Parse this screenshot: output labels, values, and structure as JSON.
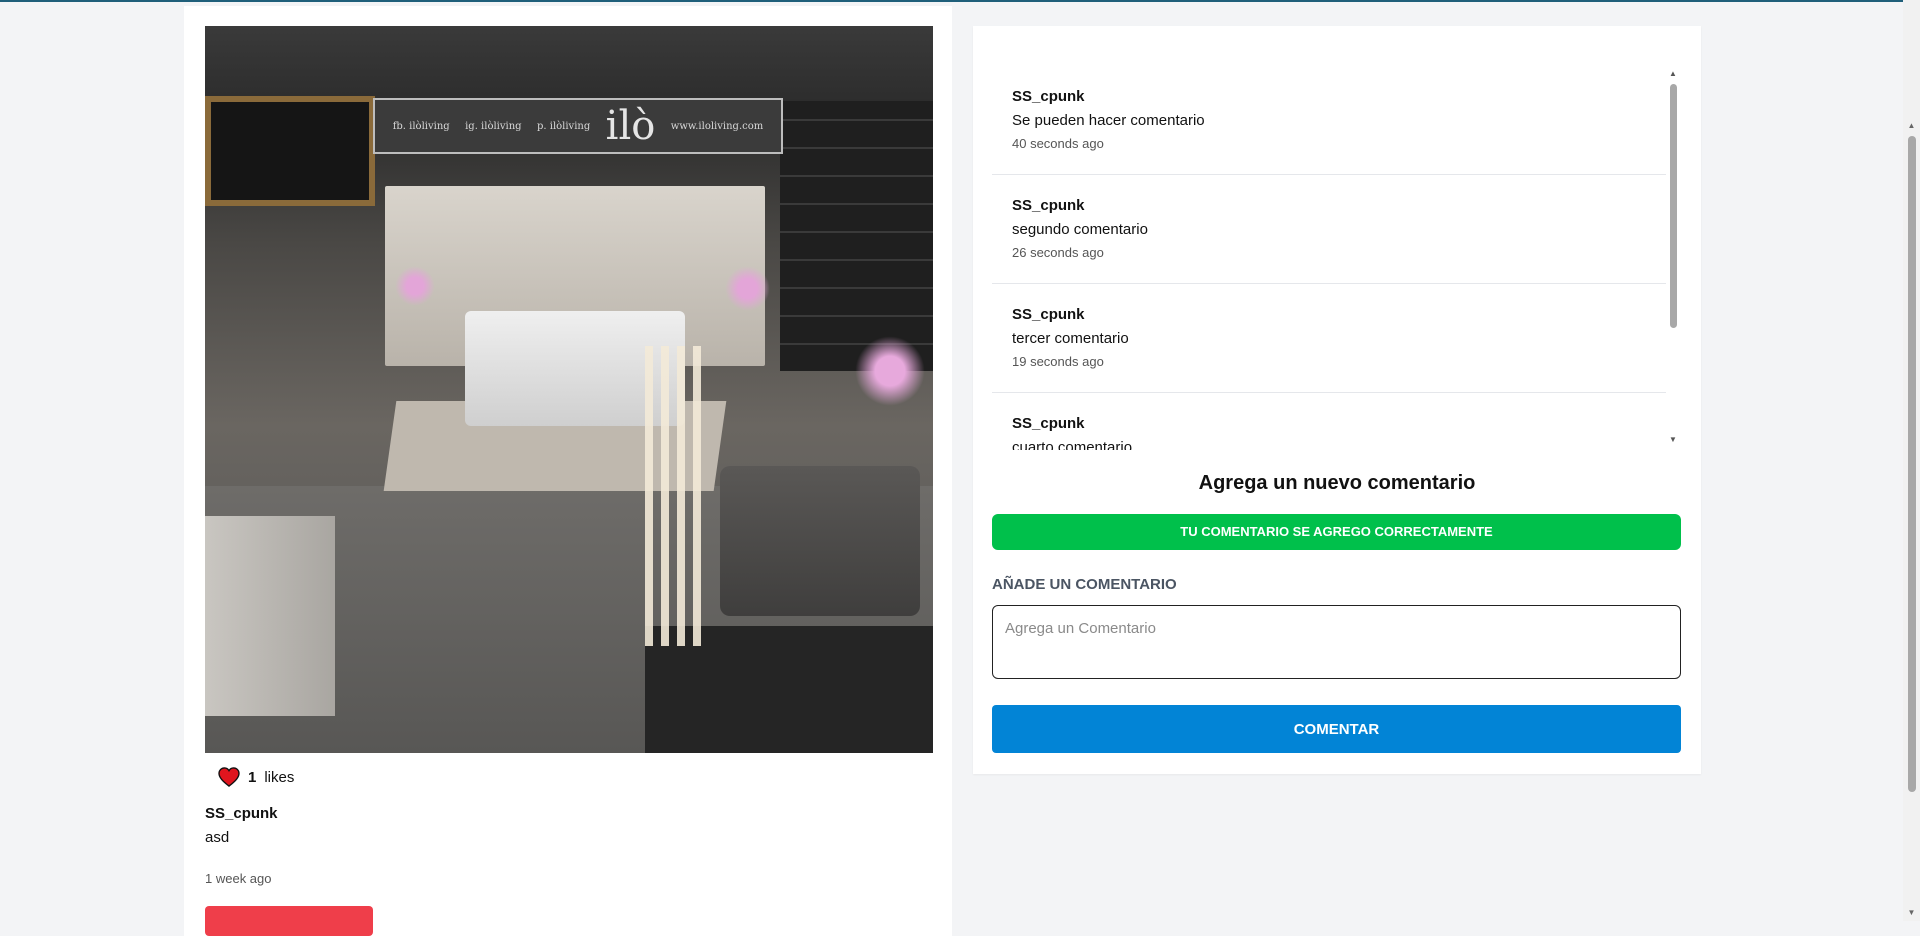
{
  "post": {
    "likes_count": "1",
    "likes_label": "likes",
    "username": "SS_cpunk",
    "description": "asd",
    "time": "1 week ago",
    "image_banner": {
      "logo": "ilò",
      "fb": "fb. ilòliving",
      "ig": "ig. ilòliving",
      "p": "p. ilòliving",
      "site": "www.iloliving.com"
    }
  },
  "comments": [
    {
      "user": "SS_cpunk",
      "text": "Se pueden hacer comentario",
      "time": "40 seconds ago"
    },
    {
      "user": "SS_cpunk",
      "text": "segundo comentario",
      "time": "26 seconds ago"
    },
    {
      "user": "SS_cpunk",
      "text": "tercer comentario",
      "time": "19 seconds ago"
    },
    {
      "user": "SS_cpunk",
      "text": "cuarto comentario",
      "time": ""
    }
  ],
  "form": {
    "heading": "Agrega un nuevo comentario",
    "success_message": "TU COMENTARIO SE AGREGO CORRECTAMENTE",
    "field_label": "AÑADE UN COMENTARIO",
    "placeholder": "Agrega un Comentario",
    "submit_label": "COMENTAR"
  },
  "icons": {
    "like": "heart-icon",
    "scroll_up": "triangle-up-icon",
    "scroll_down": "triangle-down-icon"
  },
  "colors": {
    "success": "#00c04b",
    "primary": "#0284d6",
    "danger": "#ef3e4a",
    "heart": "#e0151e"
  }
}
